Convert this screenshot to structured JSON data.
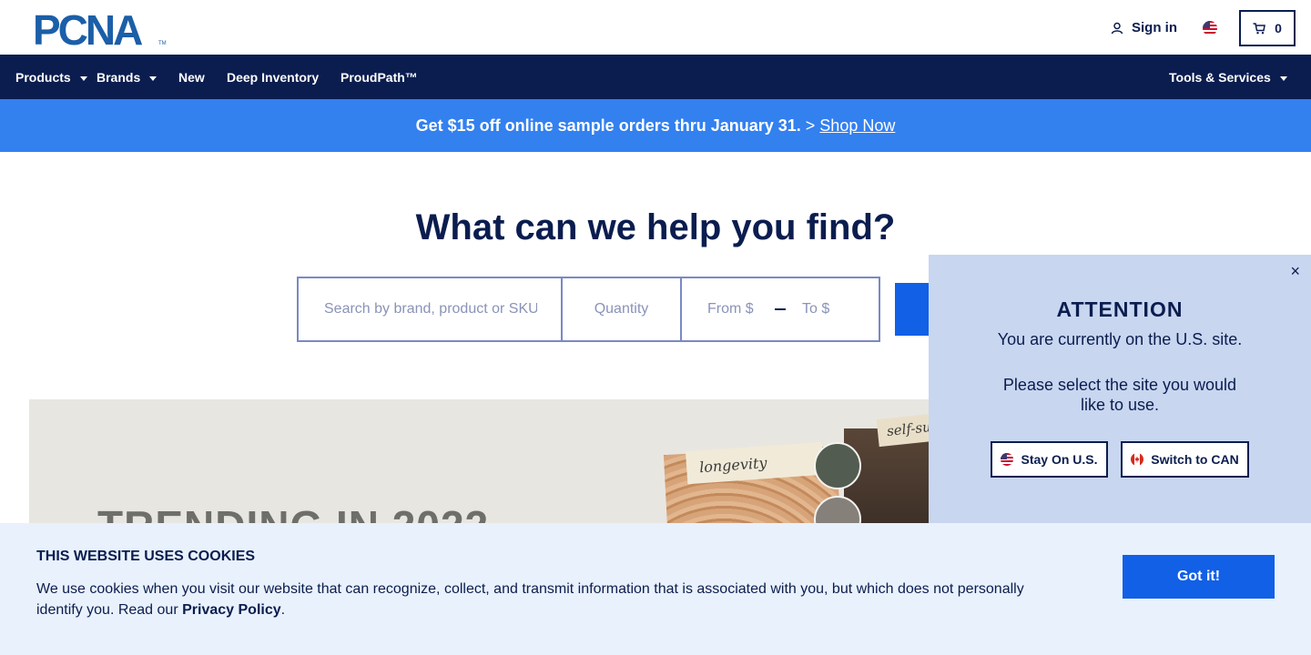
{
  "header": {
    "logo_text": "PCNA",
    "signin_label": "Sign in",
    "cart_count": "0",
    "region_flag": "us-flag-icon"
  },
  "nav": {
    "items": [
      {
        "label": "Products",
        "dropdown": true
      },
      {
        "label": "Brands",
        "dropdown": true
      },
      {
        "label": "New",
        "dropdown": false
      },
      {
        "label": "Deep Inventory",
        "dropdown": false
      },
      {
        "label": "ProudPath™",
        "dropdown": false
      }
    ],
    "right_item": {
      "label": "Tools & Services",
      "dropdown": true
    }
  },
  "promo": {
    "text": "Get $15 off online sample orders thru January 31.",
    "separator": ">",
    "link": "Shop Now"
  },
  "hero": {
    "title": "What can we help you find?",
    "search_placeholder": "Search by brand, product or SKU",
    "quantity_placeholder": "Quantity",
    "from_placeholder": "From $",
    "to_placeholder": "To $"
  },
  "banner": {
    "title": "TRENDING IN 2022",
    "tag1": "longevity",
    "tag2": "self-su"
  },
  "popup": {
    "close_label": "×",
    "title": "ATTENTION",
    "line1": "You are currently on the U.S. site.",
    "line2": "Please select the site you would like to use.",
    "stay_label": "Stay On U.S.",
    "switch_label": "Switch to CAN"
  },
  "cookie": {
    "title": "THIS WEBSITE USES COOKIES",
    "text": "We use cookies when you visit our website that can recognize, collect, and transmit information that is associated with you, but which does not personally identify you. Read our",
    "link": "Privacy Policy",
    "suffix": ".",
    "button": "Got it!"
  },
  "colors": {
    "navy": "#0b1d4f",
    "promo_blue": "#3380ef",
    "button_blue": "#1160e6",
    "popup_bg": "#c8d6f0",
    "cookie_bg": "#e9f1fc"
  }
}
